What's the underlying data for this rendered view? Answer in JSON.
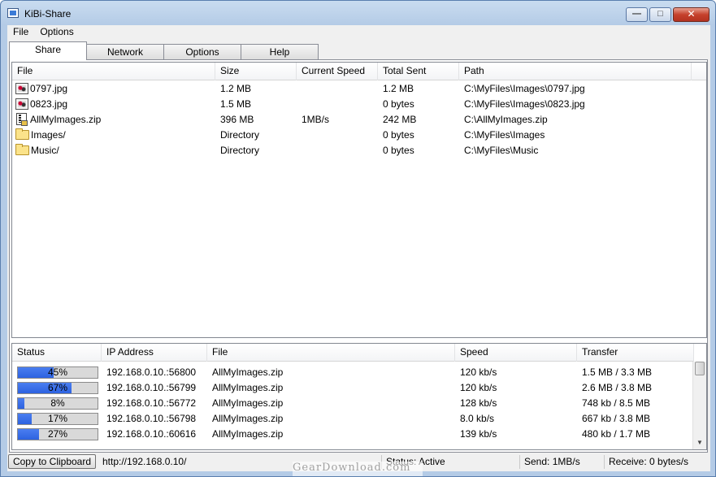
{
  "window": {
    "title": "KiBi-Share"
  },
  "menu": [
    {
      "label": "File"
    },
    {
      "label": "Options"
    }
  ],
  "tabs": [
    {
      "label": "Share",
      "active": true
    },
    {
      "label": "Network",
      "active": false
    },
    {
      "label": "Options",
      "active": false
    },
    {
      "label": "Help",
      "active": false
    }
  ],
  "files": {
    "columns": [
      "File",
      "Size",
      "Current Speed",
      "Total Sent",
      "Path"
    ],
    "rows": [
      {
        "icon": "image-file-icon",
        "name": "0797.jpg",
        "size": "1.2 MB",
        "speed": "",
        "sent": "1.2 MB",
        "path": "C:\\MyFiles\\Images\\0797.jpg"
      },
      {
        "icon": "image-file-icon",
        "name": "0823.jpg",
        "size": "1.5 MB",
        "speed": "",
        "sent": "0 bytes",
        "path": "C:\\MyFiles\\Images\\0823.jpg"
      },
      {
        "icon": "zip-file-icon",
        "name": "AllMyImages.zip",
        "size": "396 MB",
        "speed": "1MB/s",
        "sent": "242 MB",
        "path": "C:\\AllMyImages.zip"
      },
      {
        "icon": "folder-icon",
        "name": "Images/",
        "size": "Directory",
        "speed": "",
        "sent": "0 bytes",
        "path": "C:\\MyFiles\\Images"
      },
      {
        "icon": "folder-icon",
        "name": "Music/",
        "size": "Directory",
        "speed": "",
        "sent": "0 bytes",
        "path": "C:\\MyFiles\\Music"
      }
    ]
  },
  "connections": {
    "columns": [
      "Status",
      "IP Address",
      "File",
      "Speed",
      "Transfer"
    ],
    "rows": [
      {
        "status": "45%",
        "progress": 0.45,
        "ip": "192.168.0.10.:56800",
        "file": "AllMyImages.zip",
        "speed": "120 kb/s",
        "transfer": "1.5 MB / 3.3 MB"
      },
      {
        "status": "67%",
        "progress": 0.67,
        "ip": "192.168.0.10.:56799",
        "file": "AllMyImages.zip",
        "speed": "120 kb/s",
        "transfer": "2.6 MB / 3.8 MB"
      },
      {
        "status": "8%",
        "progress": 0.08,
        "ip": "192.168.0.10.:56772",
        "file": "AllMyImages.zip",
        "speed": "128 kb/s",
        "transfer": "748 kb / 8.5 MB"
      },
      {
        "status": "17%",
        "progress": 0.17,
        "ip": "192.168.0.10.:56798",
        "file": "AllMyImages.zip",
        "speed": "8.0 kb/s",
        "transfer": "667 kb / 3.8 MB"
      },
      {
        "status": "27%",
        "progress": 0.27,
        "ip": "192.168.0.10.:60616",
        "file": "AllMyImages.zip",
        "speed": "139 kb/s",
        "transfer": "480 kb / 1.7 MB"
      }
    ]
  },
  "statusbar": {
    "copy_button": "Copy to Clipboard",
    "url": "http://192.168.0.10/",
    "status": "Status: Active",
    "send": "Send: 1MB/s",
    "receive": "Receive: 0 bytes/s"
  },
  "watermark": "GearDownload.com",
  "colors": {
    "progress_fill": "#2d62e0",
    "close_button": "#c5412d"
  }
}
